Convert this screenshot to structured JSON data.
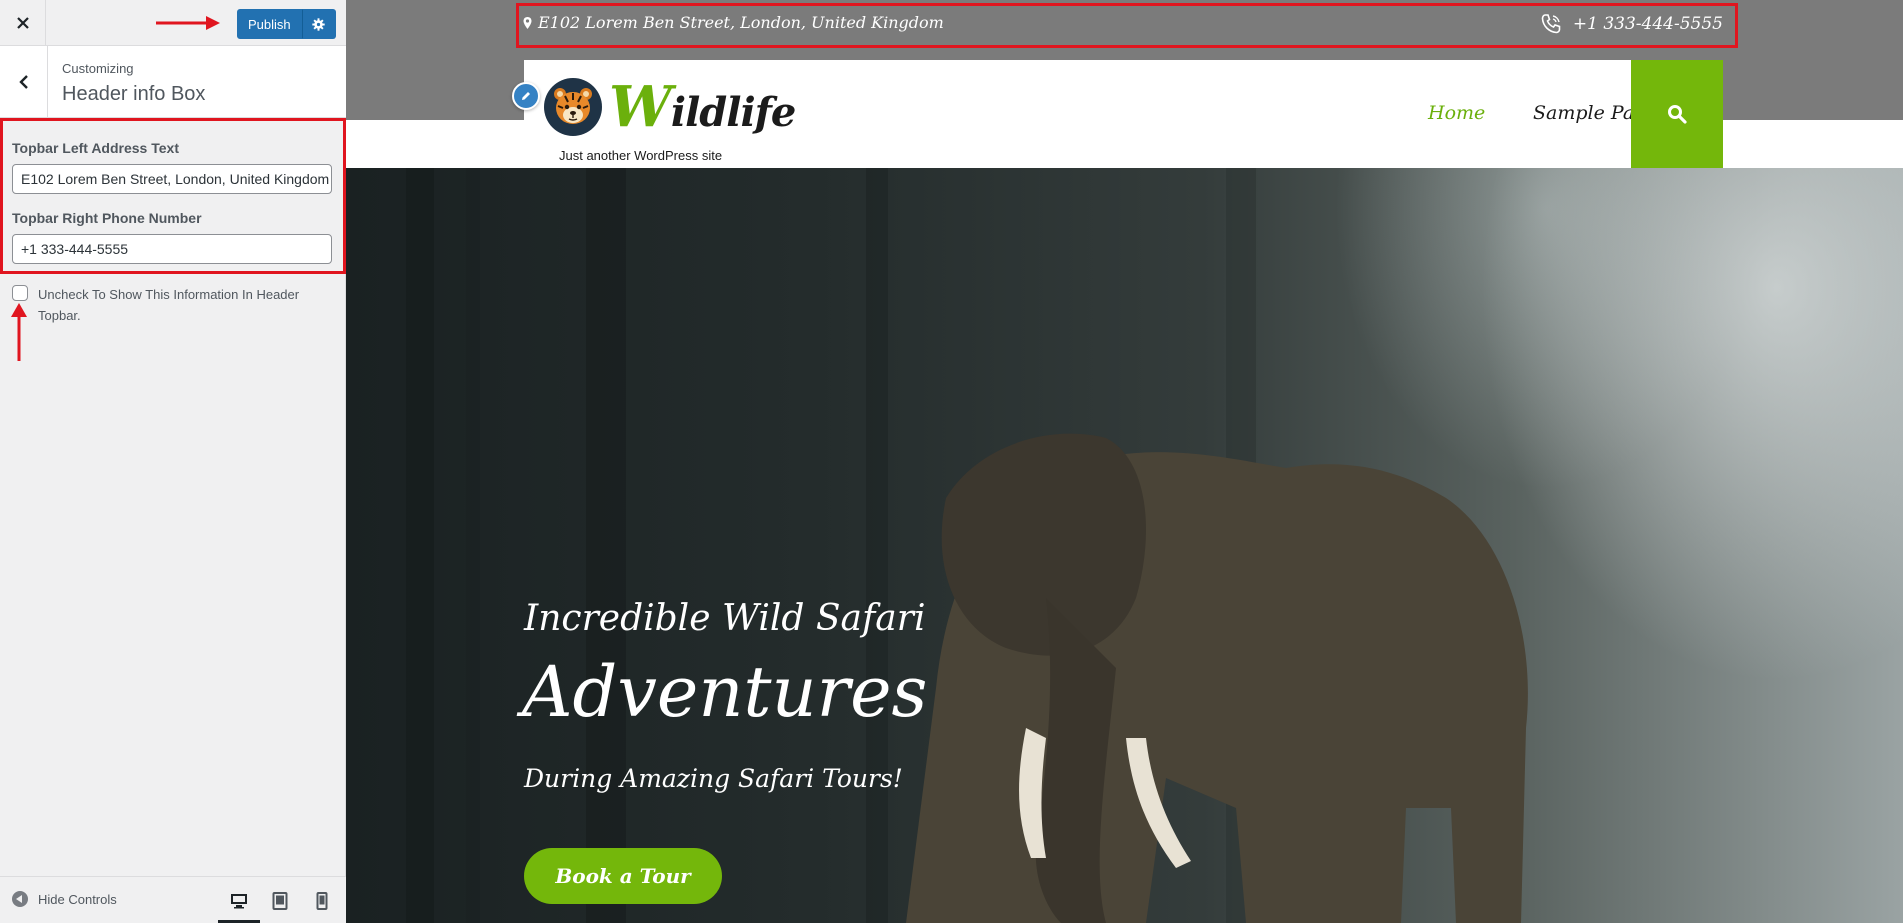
{
  "sidebar": {
    "publish_label": "Publish",
    "action_label": "Customizing",
    "section_title": "Header info Box",
    "controls": {
      "address_label": "Topbar Left Address Text",
      "address_value": "E102 Lorem Ben Street, London, United Kingdom",
      "phone_label": "Topbar Right Phone Number",
      "phone_value": "+1 333-444-5555",
      "checkbox_label": "Uncheck To Show This Information In Header Topbar.",
      "checkbox_checked": false
    },
    "footer": {
      "hide_controls_label": "Hide Controls",
      "devices": [
        "desktop-icon",
        "tablet-icon",
        "mobile-icon"
      ]
    }
  },
  "preview": {
    "topbar": {
      "address": "E102 Lorem Ben Street, London, United Kingdom",
      "phone": "+1 333-444-5555"
    },
    "site": {
      "title_first_letter": "W",
      "title_rest": "ildlife",
      "tagline": "Just another WordPress site"
    },
    "nav": {
      "items": [
        "Home",
        "Sample Page"
      ],
      "active": "Home"
    },
    "hero": {
      "line1": "Incredible Wild Safari",
      "line2": "Adventures",
      "line3": "During Amazing Safari Tours!",
      "cta": "Book a Tour"
    }
  },
  "colors": {
    "wp_primary": "#2271b1",
    "brand_green": "#74b70b",
    "annotation_red": "#e0151f",
    "topbar_gray": "#7b7b7b"
  }
}
